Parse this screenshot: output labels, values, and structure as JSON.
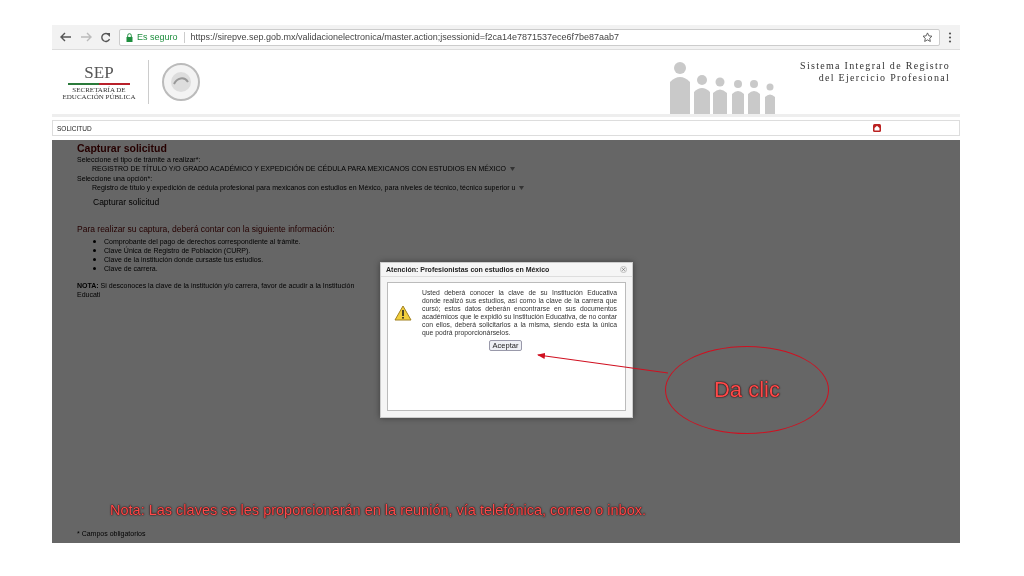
{
  "browser": {
    "secure_label": "Es seguro",
    "url": "https://sirepve.sep.gob.mx/validacionelectronica/master.action;jsessionid=f2ca14e7871537ece6f7be87aab7"
  },
  "header": {
    "logo_text": "SEP",
    "logo_subtitle": "SECRETARÍA DE EDUCACIÓN PÚBLICA",
    "system_title_lines": [
      "Sistema Integral de Registro",
      "del Ejercicio Profesional"
    ]
  },
  "section_bar": {
    "label": "SOLICITUD"
  },
  "form": {
    "title": "Capturar solicitud",
    "fields": [
      {
        "label": "Seleccione el tipo de trámite a realizar*:",
        "value": "REGISTRO DE TÍTULO Y/O GRADO ACADÉMICO Y EXPEDICIÓN DE CÉDULA PARA MEXICANOS CON ESTUDIOS EN MÉXICO"
      },
      {
        "label": "Seleccione una opción*:",
        "value": "Registro de título y expedición de cédula profesional para mexicanos con estudios en México, para niveles de técnico, técnico superior u"
      }
    ],
    "submit": "Capturar solicitud",
    "info_heading": "Para realizar su captura, deberá contar con la siguiente información:",
    "requirements": [
      "Comprobante del pago de derechos correspondiente al trámite.",
      "Clave Única de Registro de Población (CURP).",
      "Clave de la institución donde cursaste tus estudios.",
      "Clave de carrera."
    ],
    "note": "**NOTA:** Si desconoces la clave de la institución y/o carrera, favor de acudir a la Institución Educati",
    "footer": "* Campos obligatorios"
  },
  "dialog": {
    "title": "Atención: Profesionistas con estudios en México",
    "message": "Usted deberá conocer la clave de su Institución Educativa donde realizó sus estudios, así como la clave de la carrera que cursó; estos datos deberán encontrarse en sus documentos académicos que le expidió su Institución Educativa, de no contar con ellos, deberá solicitarlos a la misma, siendo esta la única que podrá proporcionárselos.",
    "button": "Aceptar"
  },
  "annotation": {
    "callout": "Da clic",
    "note": "Nota: Las claves se les proporcionarán en la reunión, vía telefónica, correo o inbox."
  }
}
